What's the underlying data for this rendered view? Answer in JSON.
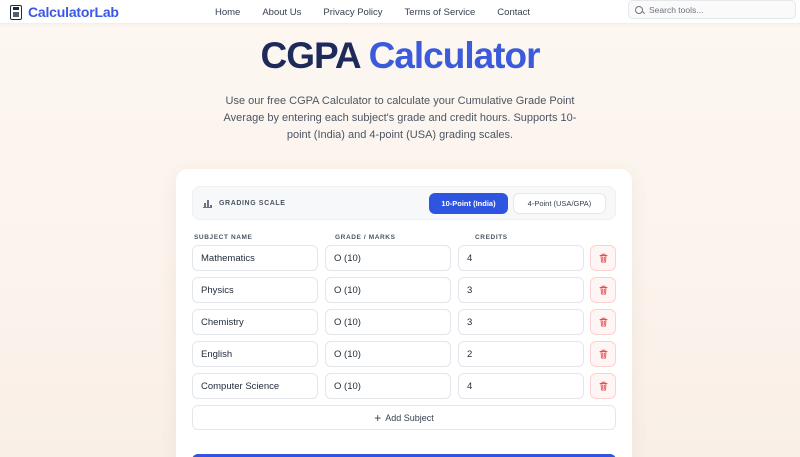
{
  "nav": {
    "brand": "CalculatorLab",
    "links": [
      "Home",
      "About Us",
      "Privacy Policy",
      "Terms of Service",
      "Contact"
    ],
    "search_placeholder": "Search tools..."
  },
  "hero": {
    "title_part1": "CGPA",
    "title_part2": "Calculator",
    "subtitle": "Use our free CGPA Calculator to calculate your Cumulative Grade Point Average by entering each subject's grade and credit hours. Supports 10-point (India) and 4-point (USA) grading scales."
  },
  "calculator": {
    "scale_label": "GRADING SCALE",
    "scale_options": [
      "10-Point (India)",
      "4-Point (USA/GPA)"
    ],
    "selected_scale": "10-Point (India)",
    "columns": [
      "SUBJECT NAME",
      "GRADE / MARKS",
      "CREDITS"
    ],
    "rows": [
      {
        "subject": "Mathematics",
        "grade": "O (10)",
        "credits": "4"
      },
      {
        "subject": "Physics",
        "grade": "O (10)",
        "credits": "3"
      },
      {
        "subject": "Chemistry",
        "grade": "O (10)",
        "credits": "3"
      },
      {
        "subject": "English",
        "grade": "O (10)",
        "credits": "2"
      },
      {
        "subject": "Computer Science",
        "grade": "O (10)",
        "credits": "4"
      }
    ],
    "add_label": "Add Subject"
  },
  "colors": {
    "accent": "#2d55e0",
    "title_dark": "#1e2a5a",
    "title_blue": "#3b5bdb",
    "delete": "#e05252"
  }
}
